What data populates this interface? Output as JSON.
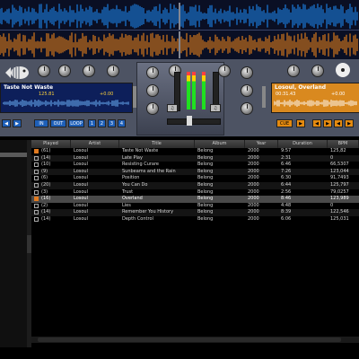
{
  "waveform": {
    "top_color": "#1e90ff",
    "bottom_color": "#ff8c1a",
    "playhead_color": "#ffffff"
  },
  "deck_left": {
    "title": "Taste Not Waste",
    "bpm": "125.81",
    "pitch": "+0.00",
    "buttons": [
      "IN",
      "OUT",
      "LOOP"
    ],
    "hotcues": [
      "1",
      "2",
      "3",
      "4"
    ],
    "accent": "#1e5fb8"
  },
  "deck_right": {
    "title": "Losoul, Overland",
    "time": "00:31.43",
    "pitch": "+0.00",
    "cue_label": "CUE",
    "accent": "#e48a10"
  },
  "library": {
    "columns": [
      "Played",
      "Artist",
      "Title",
      "Album",
      "Year",
      "Duration",
      "BPM"
    ],
    "rows": [
      {
        "checked": true,
        "played": "(61)",
        "artist": "Losoul",
        "title": "Taste Not Waste",
        "album": "Belong",
        "year": "2000",
        "duration": "9:57",
        "bpm": "125,82"
      },
      {
        "checked": false,
        "played": "(14)",
        "artist": "Losoul",
        "title": "Late Play",
        "album": "Belong",
        "year": "2000",
        "duration": "2:31",
        "bpm": "0"
      },
      {
        "checked": false,
        "played": "(10)",
        "artist": "Losoul",
        "title": "Resisting Curare",
        "album": "Belong",
        "year": "2000",
        "duration": "6:46",
        "bpm": "66,5307"
      },
      {
        "checked": false,
        "played": "(9)",
        "artist": "Losoul",
        "title": "Sunbeams and the Rain",
        "album": "Belong",
        "year": "2000",
        "duration": "7:26",
        "bpm": "123,044"
      },
      {
        "checked": false,
        "played": "(6)",
        "artist": "Losoul",
        "title": "Position",
        "album": "Belong",
        "year": "2000",
        "duration": "6:30",
        "bpm": "91,7493"
      },
      {
        "checked": false,
        "played": "(20)",
        "artist": "Losoul",
        "title": "You Can Do",
        "album": "Belong",
        "year": "2000",
        "duration": "6:44",
        "bpm": "125,797"
      },
      {
        "checked": false,
        "played": "(3)",
        "artist": "Losoul",
        "title": "Trust",
        "album": "Belong",
        "year": "2000",
        "duration": "2:56",
        "bpm": "79,0257"
      },
      {
        "checked": true,
        "played": "(16)",
        "artist": "Losoul",
        "title": "Overland",
        "album": "Belong",
        "year": "2000",
        "duration": "8:46",
        "bpm": "123,989",
        "selected": true
      },
      {
        "checked": false,
        "played": "(2)",
        "artist": "Losoul",
        "title": "Lies",
        "album": "Belong",
        "year": "2000",
        "duration": "4:48",
        "bpm": "0"
      },
      {
        "checked": false,
        "played": "(14)",
        "artist": "Losoul",
        "title": "Remember You History",
        "album": "Belong",
        "year": "2000",
        "duration": "8:39",
        "bpm": "122,546"
      },
      {
        "checked": false,
        "played": "(14)",
        "artist": "Losoul",
        "title": "Depth Control",
        "album": "Belong",
        "year": "2000",
        "duration": "6:06",
        "bpm": "125,031"
      }
    ]
  }
}
